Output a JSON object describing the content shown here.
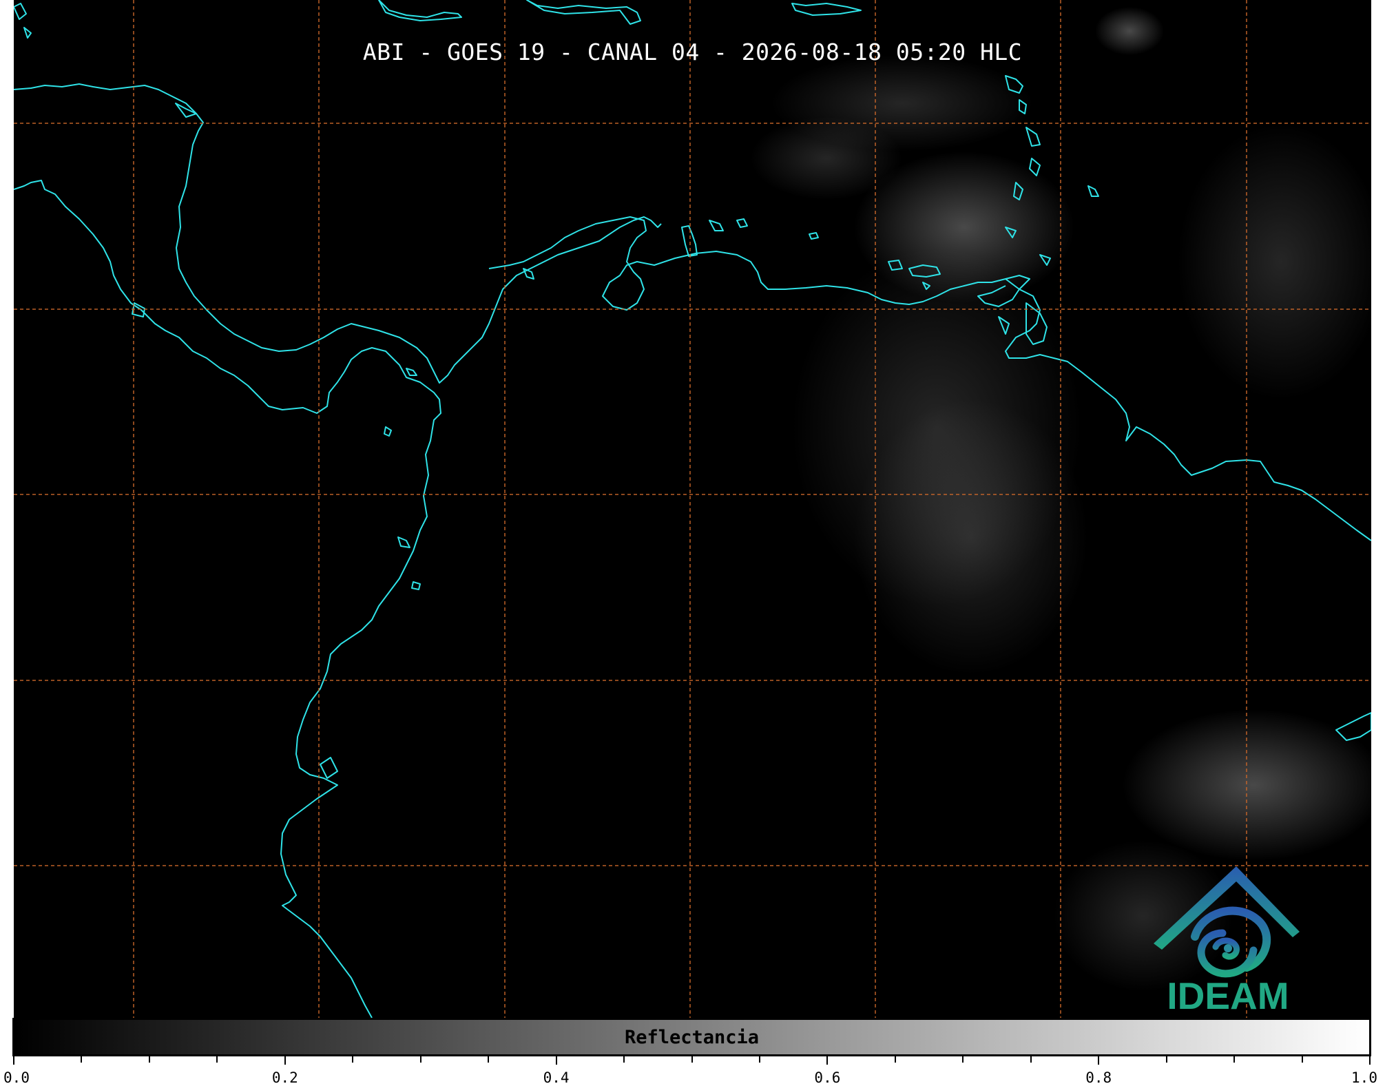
{
  "map": {
    "title": "ABI - GOES 19 - CANAL 04 - 2026-08-18 05:20 HLC",
    "coastline_color": "#2fe3e8",
    "grid_color": "#c8662a",
    "background_color": "#000000",
    "cloud_color": "#d0d0d0"
  },
  "colorbar": {
    "label": "Reflectancia",
    "range": [
      0.0,
      1.0
    ],
    "tick_labels": [
      "0.0",
      "0.2",
      "0.4",
      "0.6",
      "0.8",
      "1.0"
    ],
    "colormap": "grayscale",
    "start_color": "#000000",
    "end_color": "#ffffff"
  },
  "logo": {
    "text": "IDEAM",
    "icon": "ideam-swirl-house-icon",
    "color": "#21a884"
  }
}
